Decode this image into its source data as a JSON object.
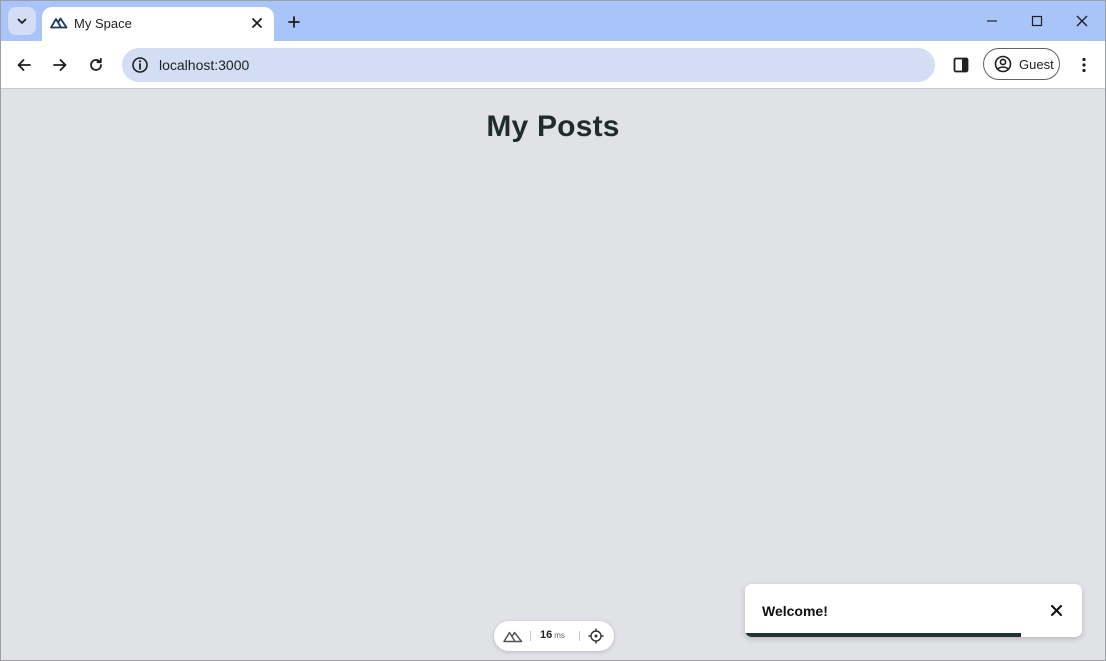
{
  "browser": {
    "tab": {
      "title": "My Space",
      "icon": "nuxt-logo-icon"
    },
    "address": {
      "url": "localhost:3000"
    },
    "profile": {
      "label": "Guest"
    }
  },
  "page": {
    "title": "My Posts"
  },
  "devtools": {
    "render_time_value": "16",
    "render_time_unit": "ms"
  },
  "toast": {
    "message": "Welcome!",
    "progress_fraction": 0.82
  },
  "colors": {
    "tabstrip": "#a8c4f8",
    "omnibox": "#d3def5",
    "page_background": "#e1e2e6",
    "title_text": "#1f2d2a",
    "toast_progress": "#24332f"
  }
}
